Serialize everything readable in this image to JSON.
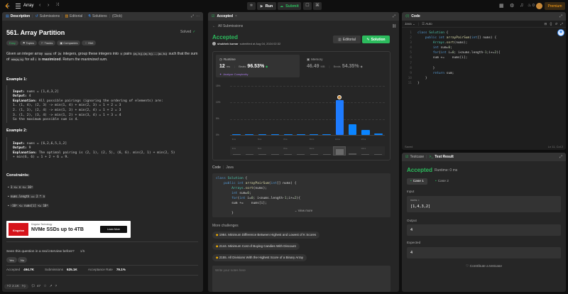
{
  "topbar": {
    "list_label": "Array",
    "run_label": "Run",
    "submit_label": "Submit",
    "streak_count": "0",
    "premium_label": "Premium"
  },
  "left_panel": {
    "tabs": {
      "description": "Description",
      "submissions": "Submissions",
      "editorial": "Editorial",
      "solutions": "Solutions",
      "click": "(Click)"
    },
    "title": "561. Array Partition",
    "solved": "Solved",
    "tags": [
      "Easy",
      "Topics",
      "Tracks",
      "Companies",
      "Hint"
    ],
    "desc_1": "Given an integer array",
    "desc_nums": "nums",
    "desc_2": "of",
    "desc_2n": "2n",
    "desc_3": "integers, group these integers into",
    "desc_n": "n",
    "desc_4": "pairs",
    "desc_pairs": "(a₁, b₁), (a₂, b₂), ..., (aₙ, bₙ)",
    "desc_5": "such that the sum of",
    "desc_min": "min(aᵢ, bᵢ)",
    "desc_6": "for all",
    "desc_i": "i",
    "desc_7": "is",
    "desc_maximized": "maximized",
    "desc_8": ". Return",
    "desc_9": "the maximized sum",
    "ex1": {
      "title": "Example 1:",
      "input_label": "Input:",
      "input": "nums = [1,4,3,2]",
      "output_label": "Output:",
      "output": "4",
      "expl_label": "Explanation:",
      "expl": "All possible pairings (ignoring the ordering of elements) are:",
      "lines": [
        "1. (1, 4), (2, 3) -> min(1, 4) + min(2, 3) = 1 + 2 = 3",
        "2. (1, 3), (2, 4) -> min(1, 3) + min(2, 4) = 1 + 2 = 3",
        "3. (1, 2), (3, 4) -> min(1, 2) + min(3, 4) = 1 + 3 = 4",
        "So the maximum possible sum is 4."
      ]
    },
    "ex2": {
      "title": "Example 2:",
      "input_label": "Input:",
      "input": "nums = [6,2,6,5,1,2]",
      "output_label": "Output:",
      "output": "9",
      "expl_label": "Explanation:",
      "expl": "The optimal pairing is (2, 1), (2, 5), (6, 6). min(2, 1) + min(2, 5)",
      "expl2": "+ min(6, 6) = 1 + 2 + 6 = 9."
    },
    "constraints_title": "Constraints:",
    "constraints": [
      "1 <= n <= 10⁴",
      "nums.length == 2 * n",
      "-10⁴ <= nums[i] <= 10⁴"
    ],
    "ad": {
      "brand": "Kingston Technology",
      "brand_short": "Kingston",
      "headline": "NVMe SSDs up to 4TB",
      "button": "Learn More"
    },
    "interview_q": "Seen this question in a real interview before?",
    "interview_pages": "1/5",
    "yes": "Yes",
    "no": "No",
    "stats": {
      "accepted_label": "Accepted",
      "accepted": "494.7K",
      "submissions_label": "Submissions",
      "submissions": "625.1K",
      "rate_label": "Acceptance Rate",
      "rate": "79.1%"
    },
    "footer": {
      "likes": "2.1K",
      "comments": "47"
    }
  },
  "mid_panel": {
    "tab": "Accepted",
    "all_submissions": "All Submissions",
    "status": "Accepted",
    "author": "shubhek kumar",
    "submitted": "submitted at Aug 04, 2024 02:32",
    "editorial_btn": "Editorial",
    "solution_btn": "Solution",
    "runtime_label": "Runtime",
    "runtime_value": "12",
    "runtime_unit": "ms",
    "beats_label": "Beats",
    "runtime_beats": "96.53%",
    "analyze": "Analyze Complexity",
    "memory_label": "Memory",
    "memory_value": "46.49",
    "memory_unit": "MB",
    "memory_beats": "54.35%",
    "code_label": "Code",
    "code_lang": "Java",
    "view_more": "View more",
    "more_challenges": "More challenges",
    "challenges": [
      "1984. Minimum Difference Between Highest and Lowest of K Scores",
      "2144. Minimum Cost of Buying Candies With Discount",
      "2155. All Divisions With the Highest Score of a Binary Array"
    ],
    "notes_placeholder": "Write your notes here"
  },
  "chart_data": {
    "type": "bar",
    "categories": [
      "2ms",
      "",
      "5ms",
      "",
      "8ms",
      "",
      "11ms",
      "",
      "14ms",
      "",
      "17ms",
      ""
    ],
    "values": [
      0.3,
      0.3,
      0.3,
      0.3,
      0.3,
      0.3,
      0.3,
      0.3,
      10.5,
      3.2,
      1.4,
      0.5
    ],
    "highlight_index": 8,
    "yticks": [
      "15%",
      "10%",
      "5%",
      "0%"
    ],
    "ylim": [
      0,
      15
    ],
    "overview_labels": [
      "2ms",
      "",
      "5ms",
      "",
      "8ms",
      "",
      "11ms",
      "",
      "",
      "",
      "14ms",
      ""
    ]
  },
  "code_panel": {
    "title": "Code",
    "lang": "Java",
    "auto": "Auto",
    "saved": "Saved",
    "cursor": "Ln 11, Col 2"
  },
  "test_panel": {
    "tab_testcase": "Testcase",
    "tab_result": "Test Result",
    "status": "Accepted",
    "runtime": "Runtime: 0 ms",
    "case1": "Case 1",
    "case2": "Case 2",
    "input_label": "Input",
    "nums_label": "nums =",
    "nums_value": "[1,4,3,2]",
    "output_label": "Output",
    "output_value": "4",
    "expected_label": "Expected",
    "expected_value": "4",
    "contribute": "Contribute a testcase"
  },
  "code_lines": [
    "class Solution {",
    "    public int arrayPairSum(int[] nums) {",
    "        Arrays.sort(nums);",
    "        int sum=0;",
    "        for(int i=0; i<nums.length-1;i+=2){",
    "        sum +=    nums[i];",
    "",
    "        }",
    "        return sum;",
    "    }",
    "}"
  ],
  "mid_code_lines": [
    "class Solution {",
    "    public int arrayPairSum(int[] nums) {",
    "        Arrays.sort(nums);",
    "        int sum=0;",
    "        for(int i=0; i<nums.length-1;i+=2){",
    "        sum +=    nums[i];",
    "",
    "        }"
  ],
  "colors": {
    "accent_green": "#2cbb5d",
    "accent_orange": "#ffa116",
    "bar_blue": "#0a84ff",
    "bg": "#0f0f0f",
    "panel": "#262626"
  }
}
